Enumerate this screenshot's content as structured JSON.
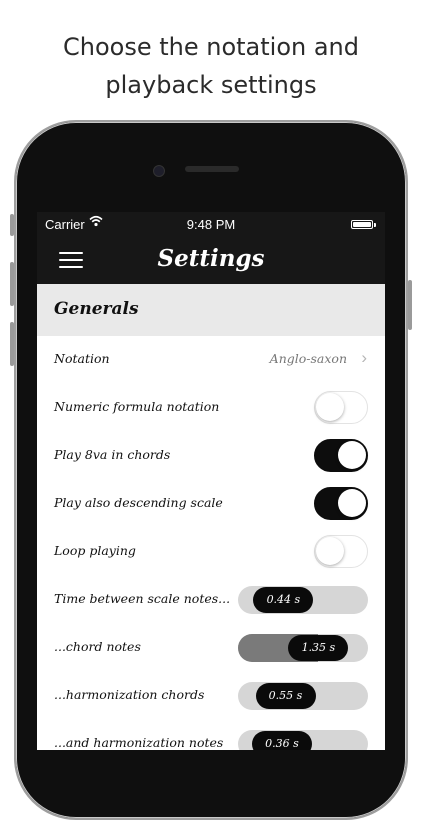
{
  "caption": {
    "line1": "Choose the notation and",
    "line2": "playback settings"
  },
  "statusbar": {
    "carrier": "Carrier",
    "wifi_icon": "wifi-icon",
    "time": "9:48 PM",
    "battery_level": 1.0
  },
  "navbar": {
    "menu_icon": "hamburger-menu-icon",
    "title": "Settings"
  },
  "section": {
    "title": "Generals"
  },
  "rows": [
    {
      "label": "Notation",
      "value": "Anglo-saxon",
      "type": "disclosure"
    },
    {
      "label": "Numeric formula notation",
      "type": "toggle",
      "on": false
    },
    {
      "label": "Play 8va in chords",
      "type": "toggle",
      "on": true
    },
    {
      "label": "Play also descending scale",
      "type": "toggle",
      "on": true
    },
    {
      "label": "Loop playing",
      "type": "toggle",
      "on": false
    },
    {
      "label": "Time between scale notes...",
      "type": "slider",
      "value_label": "0.44 s",
      "fraction": 0.22
    },
    {
      "label": "...chord notes",
      "type": "slider",
      "value_label": "1.35 s",
      "fraction": 0.72
    },
    {
      "label": "...harmonization chords",
      "type": "slider",
      "value_label": "0.55 s",
      "fraction": 0.25
    },
    {
      "label": "...and harmonization notes",
      "type": "slider",
      "value_label": "0.36 s",
      "fraction": 0.2
    }
  ],
  "colors": {
    "bar_background": "#171717",
    "section_background": "#e9e9e9",
    "toggle_on": "#0d0d0d",
    "slider_track": "#d6d6d6"
  }
}
